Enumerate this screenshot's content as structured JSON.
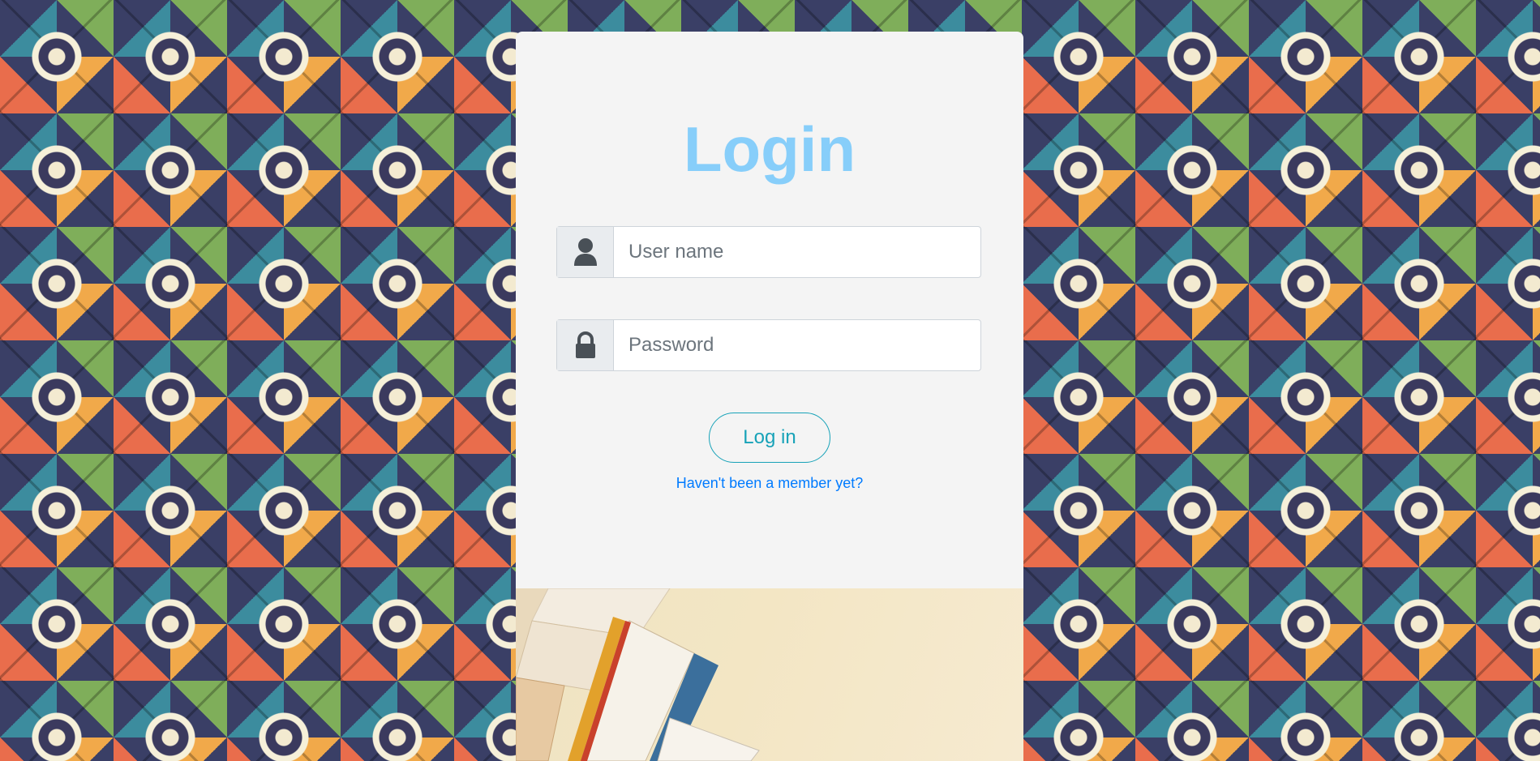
{
  "page": {
    "title": "Login"
  },
  "form": {
    "username": {
      "icon": "user-icon",
      "placeholder": "User name",
      "value": ""
    },
    "password": {
      "icon": "lock-icon",
      "placeholder": "Password",
      "value": ""
    },
    "submit_label": "Log in",
    "signup_link": "Haven't been a member yet?"
  },
  "colors": {
    "title": "#87cefa",
    "button": "#17a2b8",
    "link": "#007bff",
    "card_background": "#f4f4f4"
  }
}
